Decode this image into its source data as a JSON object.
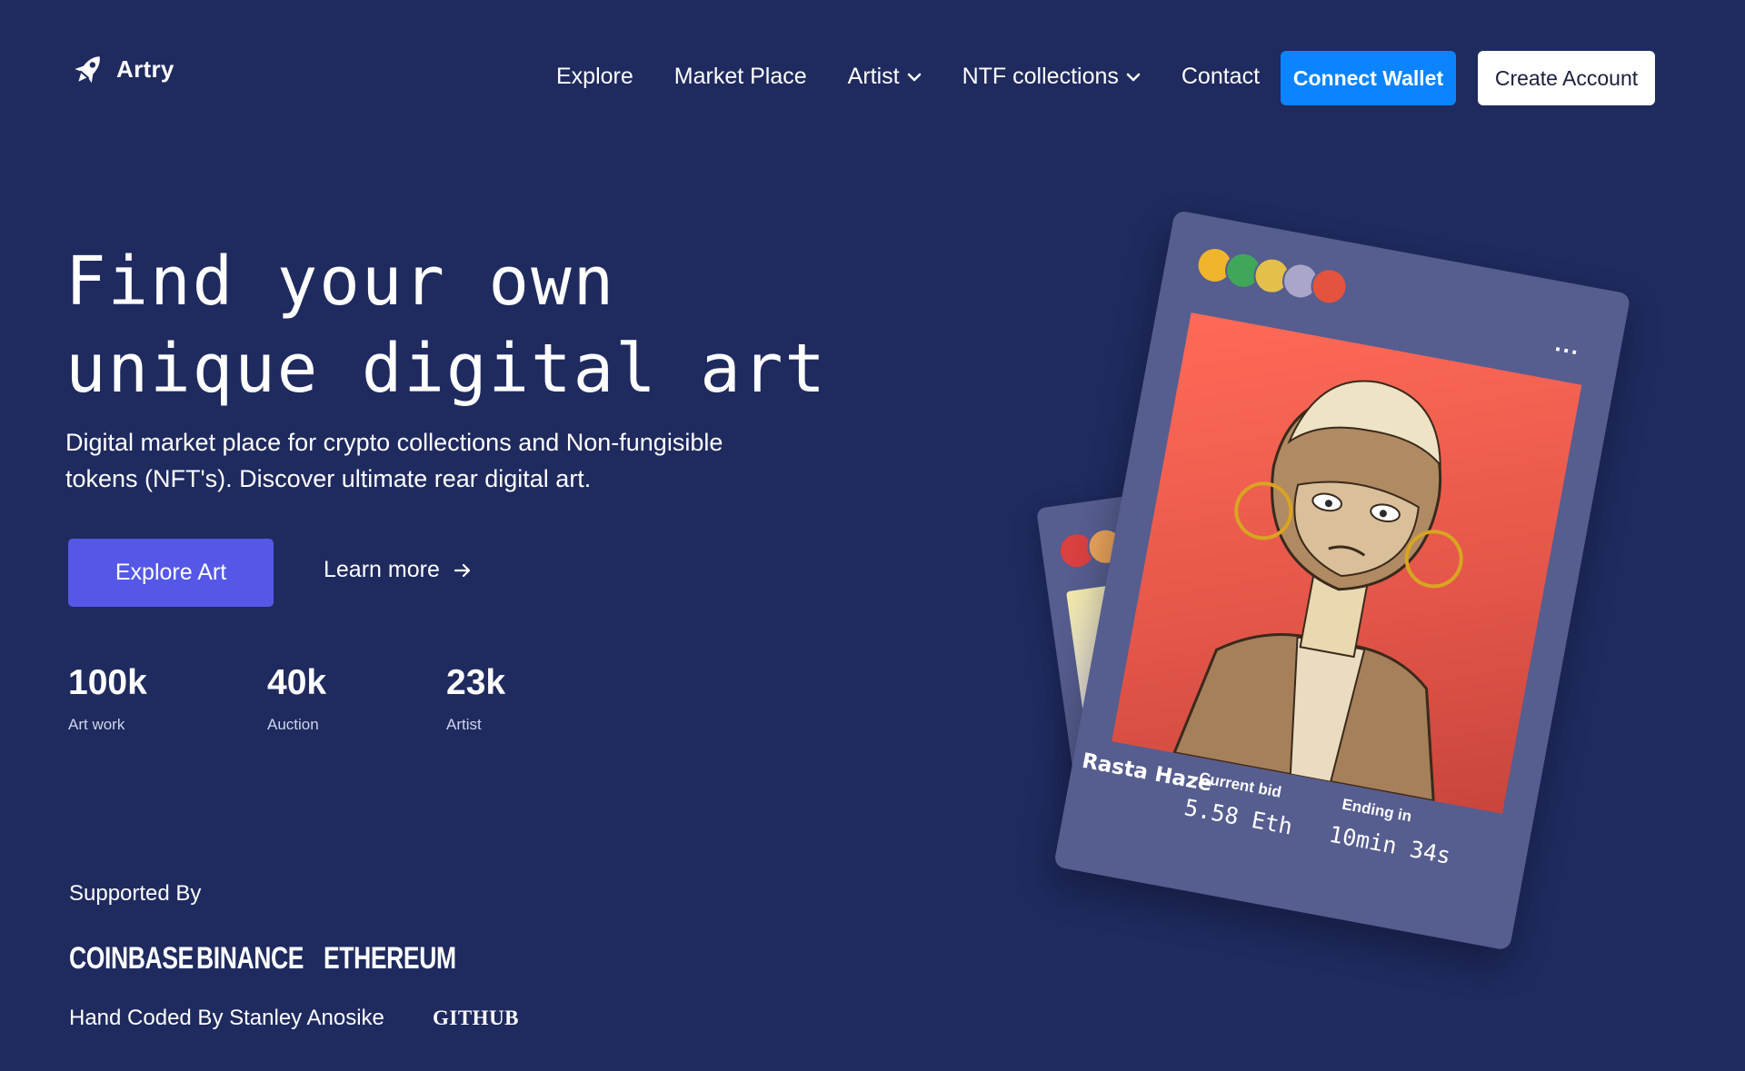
{
  "brand": {
    "name": "Artry",
    "icon": "rocket-icon"
  },
  "nav": {
    "items": [
      {
        "label": "Explore",
        "has_dropdown": false
      },
      {
        "label": "Market Place",
        "has_dropdown": false
      },
      {
        "label": "Artist",
        "has_dropdown": true
      },
      {
        "label": "NTF collections",
        "has_dropdown": true
      },
      {
        "label": "Contact",
        "has_dropdown": false
      }
    ],
    "connect_wallet": "Connect Wallet",
    "create_account": "Create Account"
  },
  "hero": {
    "title_line1": "Find your own",
    "title_line2": "unique digital art",
    "description": "Digital market place for crypto collections and Non-fungisible tokens (NFT's). Discover ultimate rear digital art.",
    "primary_button": "Explore Art",
    "secondary_link": "Learn more"
  },
  "stats": [
    {
      "value": "100k",
      "label": "Art work"
    },
    {
      "value": "40k",
      "label": "Auction"
    },
    {
      "value": "23k",
      "label": "Artist"
    }
  ],
  "supported": {
    "heading": "Supported By",
    "sponsors": [
      "COINBASE",
      "BINANCE",
      "ETHEREUM"
    ]
  },
  "footer": {
    "credit": "Hand Coded By Stanley Anosike",
    "github": "GITHUB"
  },
  "nft_front": {
    "name": "Rasta Haze",
    "bid_label": "Current bid",
    "bid_value": "5.58 Eth",
    "ending_label": "Ending in",
    "ending_value": "10min 34s",
    "menu": "..."
  },
  "colors": {
    "background": "#1f2a5e",
    "connect_button": "#0c84ff",
    "explore_button": "#5558e6",
    "card": "#565d8f",
    "art_front": "#ff6a57"
  }
}
